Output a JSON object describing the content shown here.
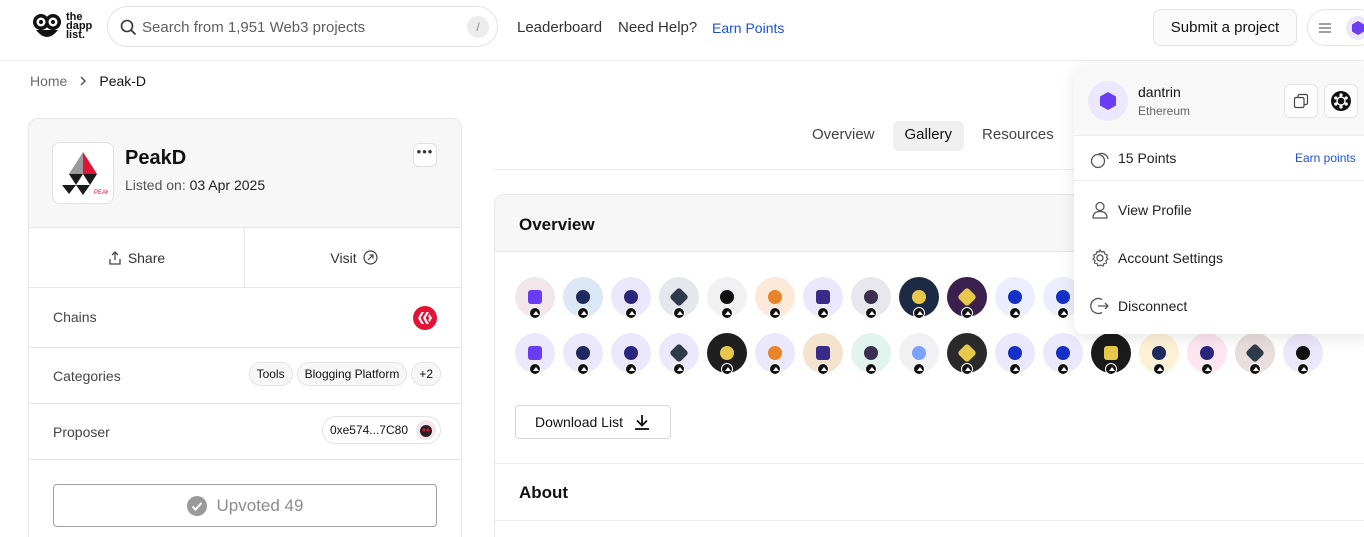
{
  "header": {
    "logo_text": "the dapp list.",
    "search_placeholder": "Search from 1,951 Web3 projects",
    "search_shortcut": "/",
    "nav": [
      "Leaderboard",
      "Need Help?",
      "Earn Points"
    ],
    "submit_label": "Submit a project",
    "icons": [
      "owl-logo-icon",
      "search-icon",
      "menu-lines-icon",
      "hexagon-avatar-icon"
    ]
  },
  "breadcrumb": {
    "home": "Home",
    "current": "Peak-D"
  },
  "project": {
    "name": "PeakD",
    "listed_label": "Listed on:",
    "listed_date": "03 Apr 2025",
    "more_label": "•••",
    "share_label": "Share",
    "visit_label": "Visit",
    "chains_label": "Chains",
    "categories_label": "Categories",
    "categories": [
      "Tools",
      "Blogging Platform",
      "+2"
    ],
    "proposer_label": "Proposer",
    "proposer_address": "0xe574...7C80",
    "upvote_label": "Upvoted 49"
  },
  "tabs": [
    "Overview",
    "Gallery",
    "Resources"
  ],
  "overview": {
    "title": "Overview",
    "download_label": "Download List",
    "about_title": "About",
    "avatar_colors_row1": [
      "#f3e6ea",
      "#dde8f6",
      "#ece8fb",
      "#e4e8ec",
      "#f1f1f3",
      "#fde9d9",
      "#ece8fb",
      "#e9e7ee",
      "#1c2a44",
      "#3b1f4d",
      "#eceefc",
      "#eceefc"
    ],
    "avatar_colors_row2": [
      "#ece8fb",
      "#ece8fb",
      "#ece8fb",
      "#ece8fb",
      "#1f1f1f",
      "#ece8fb",
      "#f4e3cf",
      "#e1f4ee",
      "#f1f1f3",
      "#2a2a2a",
      "#ece8fb",
      "#ece8fb",
      "#1a1a1a",
      "#fdf1d6",
      "#fde6ef",
      "#e8dedc",
      "#ece8fb"
    ]
  },
  "dropdown": {
    "username": "dantrin",
    "chain": "Ethereum",
    "points": "15 Points",
    "earn_points": "Earn points",
    "items": [
      "View Profile",
      "Account Settings",
      "Disconnect"
    ]
  },
  "colors": {
    "accent": "#1b53d8",
    "purple": "#6a3df5",
    "chain_red": "#e31337"
  }
}
